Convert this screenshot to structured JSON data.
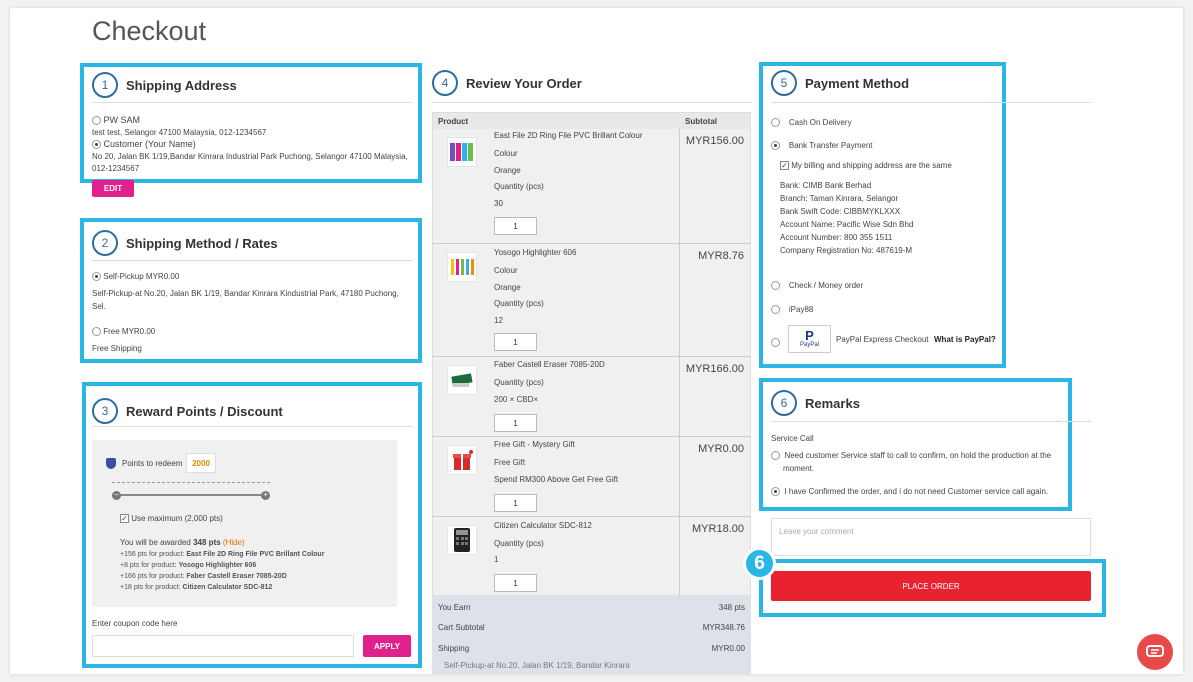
{
  "page_title": "Checkout",
  "shipping_address": {
    "step": "1",
    "title": "Shipping Address",
    "addresses": [
      {
        "name": "PW SAM",
        "detail": "test test, Selangor 47100 Malaysia, 012-1234567",
        "selected": false
      },
      {
        "name": "Customer (Your Name)",
        "detail_line1": "No 20, Jalan BK 1/19,Bandar Kinrara Industrial Park Puchong, Selangor 47100 Malaysia,",
        "detail_line2": "012-1234567",
        "selected": true
      }
    ],
    "edit_label": "EDIT"
  },
  "shipping_method": {
    "step": "2",
    "title": "Shipping Method / Rates",
    "options": [
      {
        "label": "Self-Pickup MYR0.00",
        "desc_line1": "Self-Pickup-at No.20, Jalan BK 1/19, Bandar Kinrara Kindustrial Park, 47180 Puchong,",
        "desc_line2": "Sel.",
        "selected": true
      },
      {
        "label": "Free MYR0.00",
        "desc_line1": "Free Shipping",
        "selected": false
      }
    ]
  },
  "reward": {
    "step": "3",
    "title": "Reward Points / Discount",
    "points_label": "Points to redeem",
    "points_value": "2000",
    "use_max_label": "Use maximum (2,000 pts)",
    "awarded_prefix": "You will be awarded",
    "awarded_pts": "348 pts",
    "hide_label": "(Hide)",
    "breakdown": [
      {
        "pts": "+156 pts for product:",
        "product": "East File 2D Ring File PVC Brillant Colour"
      },
      {
        "pts": "+8 pts for product:",
        "product": "Yosogo Highlighter 606"
      },
      {
        "pts": "+166 pts for product:",
        "product": "Faber Castell Eraser 7085-20D"
      },
      {
        "pts": "+18 pts for product:",
        "product": "Citizen Calculator SDC-812"
      }
    ],
    "coupon_label": "Enter coupon code here",
    "apply_label": "APPLY"
  },
  "review": {
    "step": "4",
    "title": "Review Your Order",
    "col_product": "Product",
    "col_subtotal": "Subtotal",
    "items": [
      {
        "name": "East File 2D Ring File PVC Brillant Colour",
        "price": "MYR156.00",
        "lines": [
          "Colour",
          "Orange",
          "Quantity (pcs)",
          "30"
        ],
        "qty": "1"
      },
      {
        "name": "Yosogo Highlighter 606",
        "price": "MYR8.76",
        "lines": [
          "Colour",
          "Orange",
          "Quantity (pcs)",
          "12"
        ],
        "qty": "1"
      },
      {
        "name": "Faber Castell Eraser 7085-20D",
        "price": "MYR166.00",
        "lines": [
          "Quantity (pcs)",
          "200 × CBD×"
        ],
        "qty": "1"
      },
      {
        "name": "Free Gift - Mystery Gift",
        "price": "MYR0.00",
        "lines": [
          "Free Gift",
          "Spend RM300 Above Get Free Gift"
        ],
        "qty": "1"
      },
      {
        "name": "Citizen Calculator SDC-812",
        "price": "MYR18.00",
        "lines": [
          "Quantity (pcs)",
          "1"
        ],
        "qty": "1"
      }
    ],
    "summary": [
      {
        "label": "You Earn",
        "value": "348 pts"
      },
      {
        "label": "Cart Subtotal",
        "value": "MYR348.76"
      },
      {
        "label": "Shipping",
        "value": "MYR0.00"
      }
    ],
    "shipping_note": "Self-Pickup-at No.20, Jalan BK 1/19, Bandar Kinrara"
  },
  "payment": {
    "step": "5",
    "title": "Payment Method",
    "cod": "Cash On Delivery",
    "bank_transfer": "Bank Transfer Payment",
    "same_address": "My billing and shipping address are the same",
    "bank_details": [
      "Bank: CIMB Bank Berhad",
      "Branch: Taman Kinrara, Selangor",
      "Bank Swift Code: CIBBMYKLXXX",
      "Account Name: Pacific Wise Sdn Bhd",
      "Account Number: 800 355 1511",
      "Company Registration No: 487619-M"
    ],
    "check": "Check / Money order",
    "ipay": "iPay88",
    "paypal_logo": "PayPal",
    "paypal": "PayPal Express Checkout",
    "what_is_paypal": "What is PayPal?"
  },
  "remarks": {
    "step": "6",
    "title": "Remarks",
    "service_call": "Service Call",
    "option1_line1": "Need customer Service staff to call to confirm, on hold the production at the",
    "option1_line2": "moment.",
    "option2": "I have Confirmed the order, and i do not need Customer service call again.",
    "comment_placeholder": "Leave your comment"
  },
  "callout_number": "6",
  "place_order_label": "PLACE ORDER",
  "colors": {
    "highlight": "#2ab7e6",
    "pink": "#e0208c",
    "red": "#e8232f",
    "step": "#2c6f9e"
  }
}
